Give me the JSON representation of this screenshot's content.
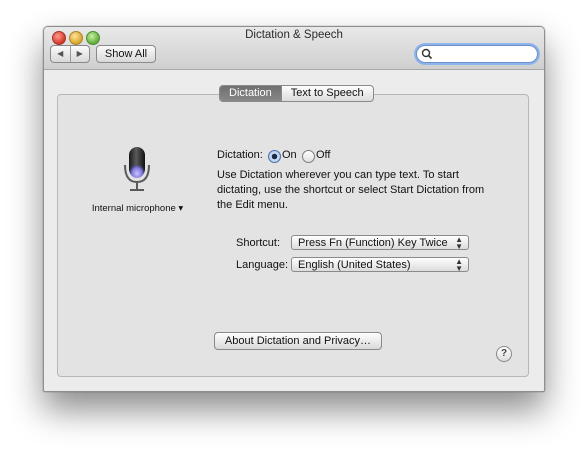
{
  "window": {
    "title": "Dictation & Speech",
    "toolbar": {
      "back_icon": "◀",
      "forward_icon": "▶",
      "show_all_label": "Show All",
      "search": {
        "value": "",
        "placeholder": ""
      }
    }
  },
  "tabs": [
    {
      "label": "Dictation",
      "active": true
    },
    {
      "label": "Text to Speech",
      "active": false
    }
  ],
  "dictation": {
    "microphone_label": "Internal microphone ▾",
    "dictation_label": "Dictation:",
    "on_label": "On",
    "off_label": "Off",
    "selected": "On",
    "description": "Use Dictation wherever you can type text. To start dictating, use the shortcut or select Start Dictation from the Edit menu.",
    "shortcut_label": "Shortcut:",
    "shortcut_value": "Press Fn (Function) Key Twice",
    "language_label": "Language:",
    "language_value": "English (United States)",
    "about_button": "About Dictation and Privacy…",
    "help_label": "?"
  },
  "colors": {
    "active_tab": "#7a7a7a",
    "search_focus": "#8eb4ec",
    "mic_glow": "#7d76d8"
  }
}
